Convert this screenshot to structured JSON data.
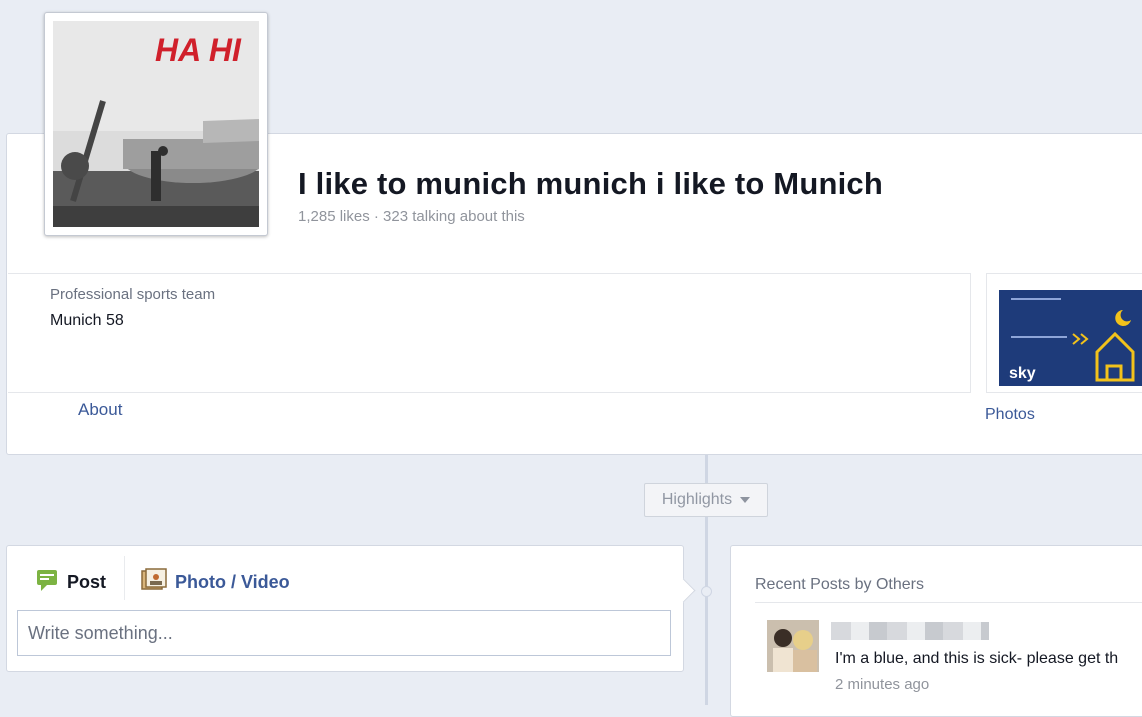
{
  "page": {
    "title": "I like to munich munich i like to Munich",
    "stats": "1,285 likes · 323 talking about this",
    "profile_picture_text": "HA HI"
  },
  "about": {
    "category": "Professional sports team",
    "value": "Munich 58",
    "link_label": "About"
  },
  "photos": {
    "link_label": "Photos",
    "thumb_brand": "sky"
  },
  "timeline": {
    "highlights_label": "Highlights"
  },
  "composer": {
    "tabs": [
      {
        "label": "Post",
        "icon": "speech-bubble-icon"
      },
      {
        "label": "Photo / Video",
        "icon": "photo-icon"
      }
    ],
    "placeholder": "Write something..."
  },
  "recent_posts": {
    "title": "Recent Posts by Others",
    "items": [
      {
        "text": "I'm a blue, and this is sick- please get th",
        "time": "2 minutes ago"
      }
    ]
  },
  "colors": {
    "link": "#3b5998",
    "background": "#e9edf4",
    "annotation_red": "#d0202b"
  }
}
